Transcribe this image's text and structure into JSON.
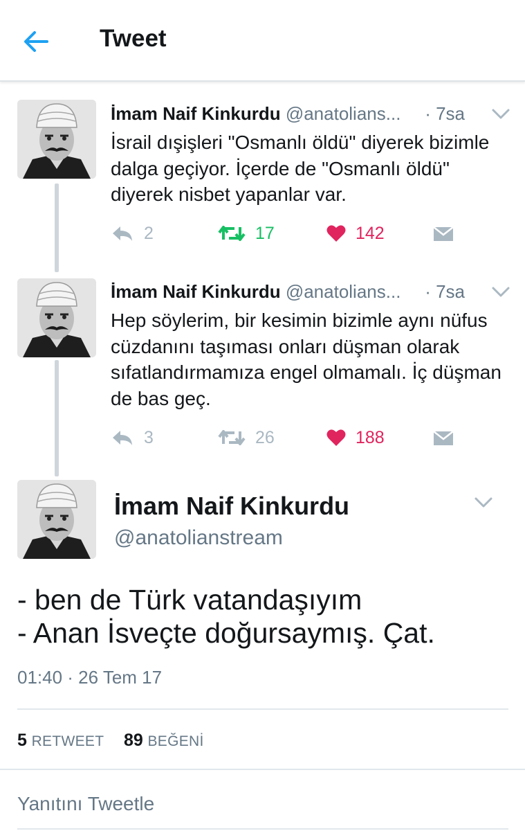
{
  "header": {
    "title": "Tweet",
    "back_icon": "arrow-left-icon"
  },
  "thread": [
    {
      "name": "İmam Naif Kinkurdu",
      "handle": "@anatolians...",
      "time": "· 7sa",
      "text": "İsrail dışişleri \"Osmanlı öldü\" diyerek bizimle dalga geçiyor. İçerde de \"Osmanlı öldü\" diyerek nisbet yapanlar var.",
      "replies": "2",
      "retweets": "17",
      "likes": "142",
      "retweeted": true
    },
    {
      "name": "İmam Naif Kinkurdu",
      "handle": "@anatolians...",
      "time": "· 7sa",
      "text": "Hep söylerim, bir kesimin bizimle aynı nüfus cüzdanını taşıması onları düşman olarak sıfatlandırmamıza engel olmamalı. İç düşman de bas geç.",
      "replies": "3",
      "retweets": "26",
      "likes": "188",
      "retweeted": false
    }
  ],
  "main": {
    "name": "İmam Naif Kinkurdu",
    "handle": "@anatolianstream",
    "line1": "- ben de Türk vatandaşıyım",
    "line2": "- Anan İsveçte doğursaymış. Çat.",
    "timestamp": "01:40 · 26 Tem 17",
    "retweet_count": "5",
    "retweet_label": "RETWEET",
    "like_count": "89",
    "like_label": "BEĞENİ"
  },
  "reply": {
    "placeholder": "Yanıtını Tweetle"
  },
  "colors": {
    "accent": "#1da1f2",
    "retweet_active": "#17bf63",
    "like": "#e0245e",
    "muted": "#657786",
    "icon_gray": "#aab8c2"
  }
}
